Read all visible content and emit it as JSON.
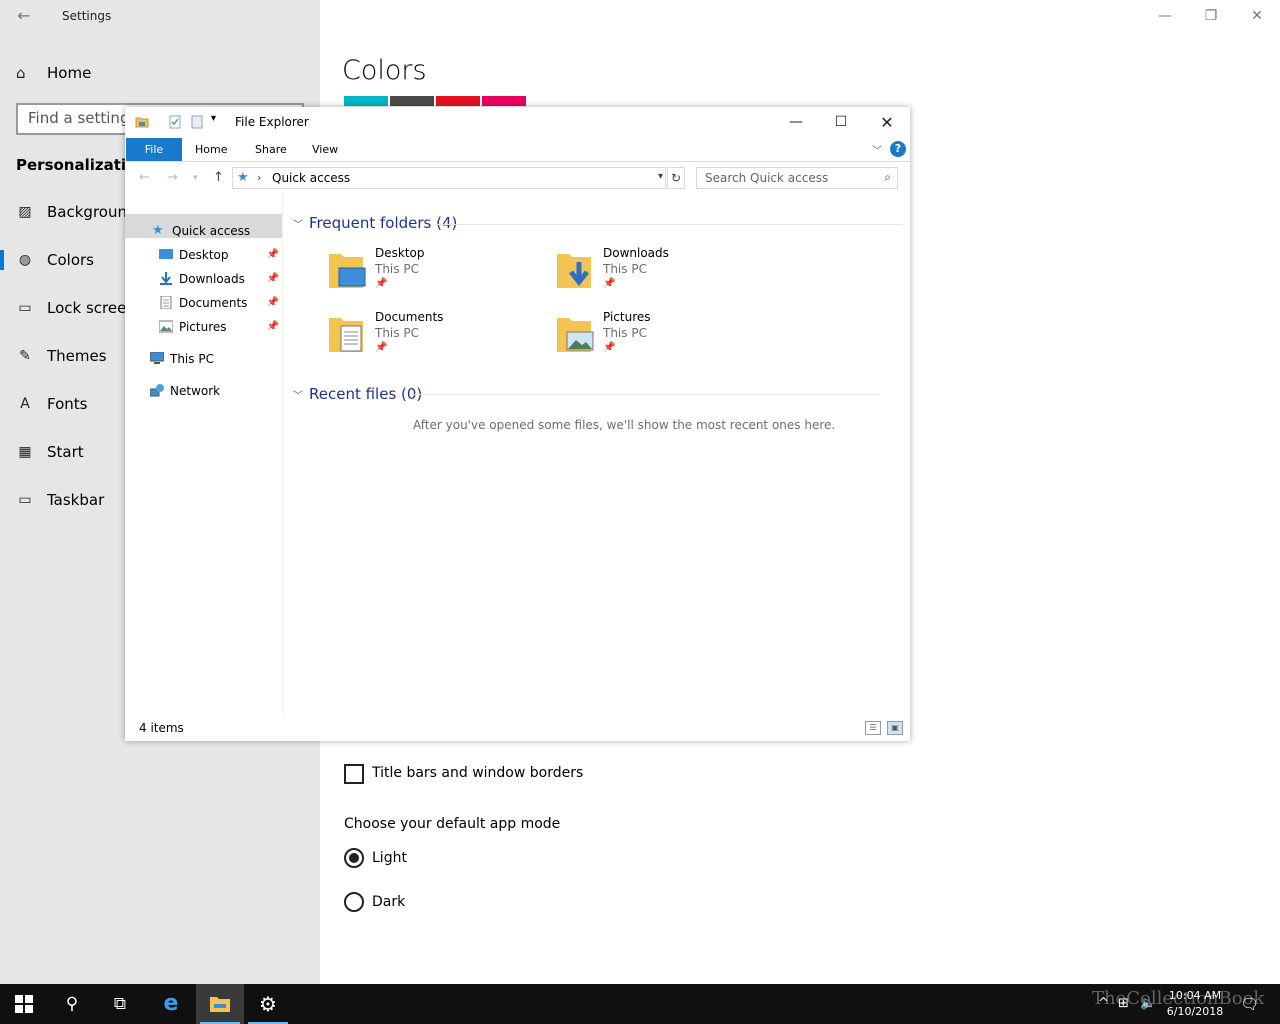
{
  "settings": {
    "window_title": "Settings",
    "home_label": "Home",
    "search_placeholder": "Find a setting",
    "section_label": "Personalization",
    "nav_items": [
      {
        "label": "Background",
        "icon": "picture-icon"
      },
      {
        "label": "Colors",
        "icon": "palette-icon"
      },
      {
        "label": "Lock screen",
        "icon": "lock-screen-icon"
      },
      {
        "label": "Themes",
        "icon": "brush-icon"
      },
      {
        "label": "Fonts",
        "icon": "font-icon"
      },
      {
        "label": "Start",
        "icon": "start-tiles-icon"
      },
      {
        "label": "Taskbar",
        "icon": "taskbar-icon"
      }
    ],
    "page_title": "Colors",
    "swatches": [
      "#00b7c3",
      "#4c4a48",
      "#e81123",
      "#ea005e"
    ],
    "title_bars_label": "Title bars and window borders",
    "title_bars_checked": false,
    "app_mode_heading": "Choose your default app mode",
    "app_modes": [
      {
        "label": "Light",
        "selected": true
      },
      {
        "label": "Dark",
        "selected": false
      }
    ]
  },
  "explorer": {
    "title": "File Explorer",
    "ribbon_tabs": {
      "file": "File",
      "home": "Home",
      "share": "Share",
      "view": "View"
    },
    "help": "?",
    "address_path": "Quick access",
    "search_placeholder": "Search Quick access",
    "nav_pane": {
      "quick_access": "Quick access",
      "pinned": [
        "Desktop",
        "Downloads",
        "Documents",
        "Pictures"
      ],
      "this_pc": "This PC",
      "network": "Network"
    },
    "frequent_header": "Frequent folders (4)",
    "frequent_folders": [
      {
        "name": "Desktop",
        "location": "This PC"
      },
      {
        "name": "Downloads",
        "location": "This PC"
      },
      {
        "name": "Documents",
        "location": "This PC"
      },
      {
        "name": "Pictures",
        "location": "This PC"
      }
    ],
    "recent_header": "Recent files (0)",
    "recent_empty": "After you've opened some files, we'll show the most recent ones here.",
    "status": "4 items"
  },
  "taskbar": {
    "time": "10:04 AM",
    "date": "6/10/2018",
    "apps": [
      "start-icon",
      "search-icon",
      "task-view-icon",
      "internet-explorer-icon",
      "file-explorer-icon",
      "settings-gear-icon"
    ]
  },
  "watermark": "TheCollectionBook",
  "colors": {
    "accent": "#0078d7",
    "sidebar_bg": "#e6e6e6",
    "ribbon_file": "#1979ca",
    "group_header": "#1e3287",
    "taskbar_bg": "#101010"
  }
}
